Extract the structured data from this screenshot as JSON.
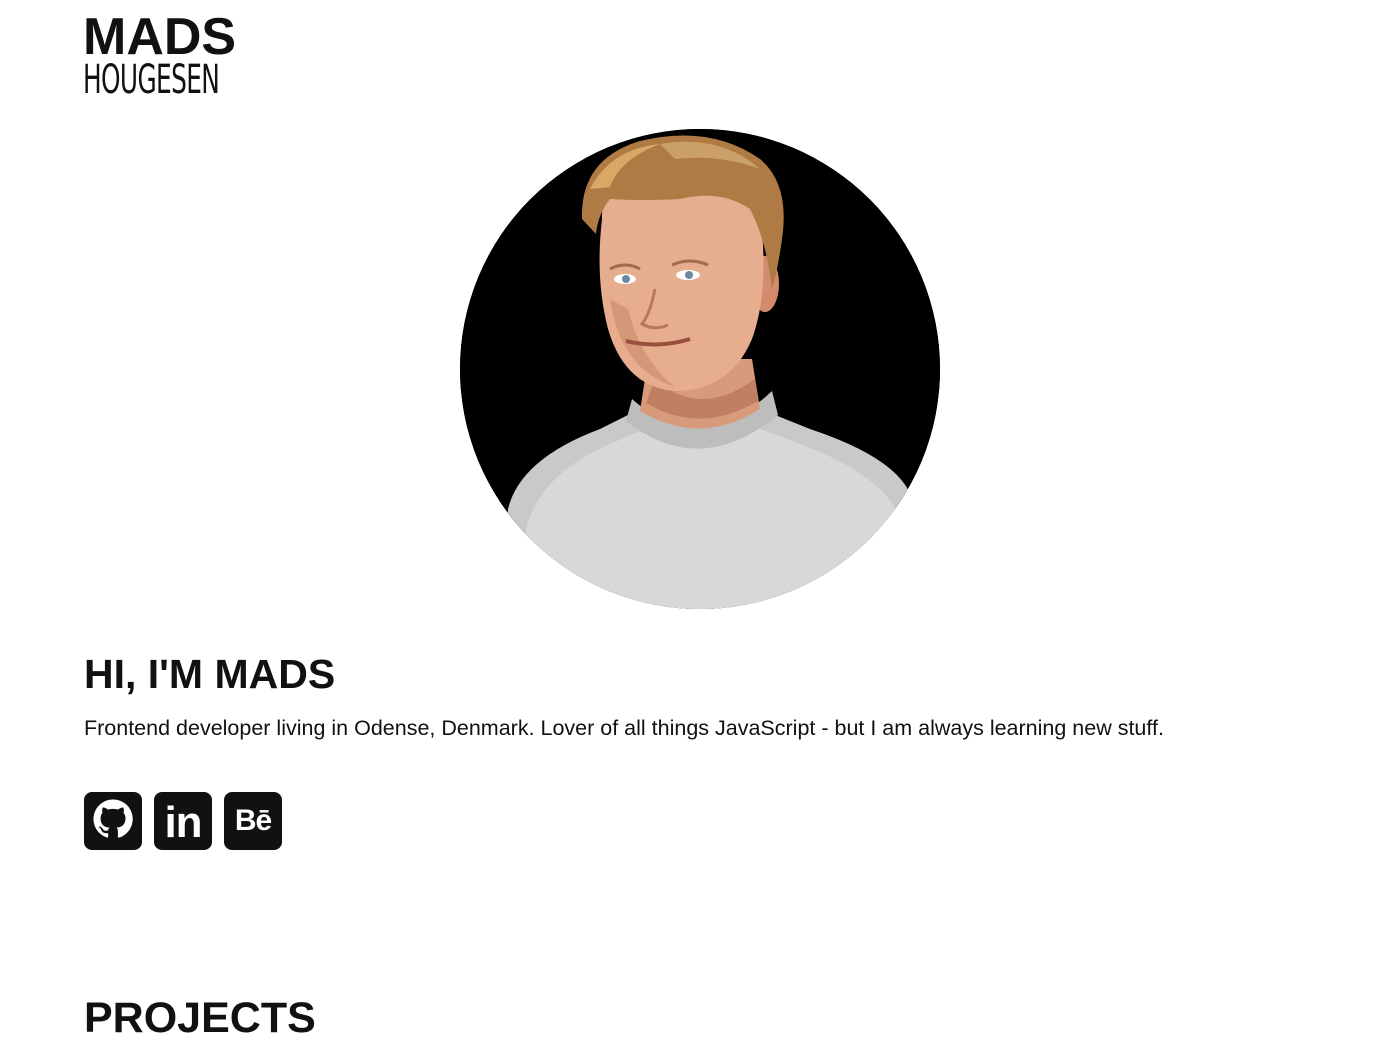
{
  "logo": {
    "line1": "MADS",
    "line2": "HOUGESEN"
  },
  "profile": {
    "photo_icon": "portrait-photo"
  },
  "hero": {
    "greeting": "HI, I'M MADS",
    "bio": "Frontend developer living in Odense, Denmark. Lover of all things JavaScript - but I am always learning new stuff."
  },
  "socials": [
    {
      "name": "GitHub",
      "icon": "github-icon"
    },
    {
      "name": "LinkedIn",
      "icon": "linkedin-icon",
      "glyph": "in"
    },
    {
      "name": "Behance",
      "icon": "behance-icon",
      "glyph": "Bē"
    }
  ],
  "sections": {
    "projects_title": "PROJECTS"
  },
  "colors": {
    "text": "#111111",
    "background": "#ffffff",
    "icon_bg": "#111111",
    "avatar_bg": "#000000"
  }
}
